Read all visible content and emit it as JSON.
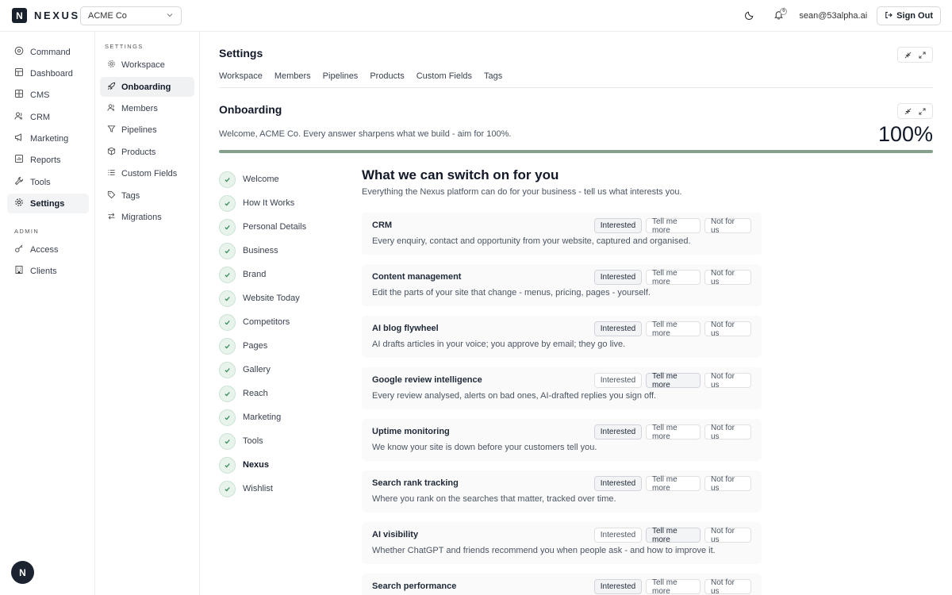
{
  "topbar": {
    "logo_letter": "N",
    "logo_text": "NEXUS",
    "workspace": "ACME Co",
    "notifications": "6",
    "user": "sean@53alpha.ai",
    "sign_out": "Sign Out"
  },
  "nav": [
    {
      "label": "Command",
      "icon": "command-icon"
    },
    {
      "label": "Dashboard",
      "icon": "dashboard-icon"
    },
    {
      "label": "CMS",
      "icon": "cms-icon"
    },
    {
      "label": "CRM",
      "icon": "crm-icon"
    },
    {
      "label": "Marketing",
      "icon": "megaphone-icon"
    },
    {
      "label": "Reports",
      "icon": "reports-icon"
    },
    {
      "label": "Tools",
      "icon": "wrench-icon"
    },
    {
      "label": "Settings",
      "icon": "gear-icon",
      "active": true
    }
  ],
  "admin": {
    "label": "ADMIN",
    "items": [
      {
        "label": "Access",
        "icon": "key-icon"
      },
      {
        "label": "Clients",
        "icon": "building-icon"
      }
    ]
  },
  "fab_letter": "N",
  "settings_nav": {
    "label": "SETTINGS",
    "items": [
      {
        "label": "Workspace",
        "icon": "gear-icon"
      },
      {
        "label": "Onboarding",
        "icon": "rocket-icon",
        "active": true
      },
      {
        "label": "Members",
        "icon": "users-icon"
      },
      {
        "label": "Pipelines",
        "icon": "funnel-icon"
      },
      {
        "label": "Products",
        "icon": "box-icon"
      },
      {
        "label": "Custom Fields",
        "icon": "list-icon"
      },
      {
        "label": "Tags",
        "icon": "tag-icon"
      },
      {
        "label": "Migrations",
        "icon": "migrate-icon"
      }
    ]
  },
  "main": {
    "title": "Settings",
    "tabs": [
      "Workspace",
      "Members",
      "Pipelines",
      "Products",
      "Custom Fields",
      "Tags"
    ]
  },
  "onboarding": {
    "title": "Onboarding",
    "welcome": "Welcome, ACME Co. Every answer sharpens what we build - aim for 100%.",
    "progress_label": "100%",
    "progress_value": 1.0,
    "steps": [
      {
        "label": "Welcome"
      },
      {
        "label": "How It Works"
      },
      {
        "label": "Personal Details"
      },
      {
        "label": "Business"
      },
      {
        "label": "Brand"
      },
      {
        "label": "Website Today"
      },
      {
        "label": "Competitors"
      },
      {
        "label": "Pages"
      },
      {
        "label": "Gallery"
      },
      {
        "label": "Reach"
      },
      {
        "label": "Marketing"
      },
      {
        "label": "Tools"
      },
      {
        "label": "Nexus",
        "current": true
      },
      {
        "label": "Wishlist"
      }
    ]
  },
  "services": {
    "title": "What we can switch on for you",
    "subtitle": "Everything the Nexus platform can do for your business - tell us what interests you.",
    "buttons": {
      "interested": "Interested",
      "tell": "Tell me more",
      "not": "Not for us"
    },
    "items": [
      {
        "title": "CRM",
        "desc": "Every enquiry, contact and opportunity from your website, captured and organised.",
        "choice": "interested"
      },
      {
        "title": "Content management",
        "desc": "Edit the parts of your site that change - menus, pricing, pages - yourself.",
        "choice": "interested"
      },
      {
        "title": "AI blog flywheel",
        "desc": "AI drafts articles in your voice; you approve by email; they go live.",
        "choice": "interested"
      },
      {
        "title": "Google review intelligence",
        "desc": "Every review analysed, alerts on bad ones, AI-drafted replies you sign off.",
        "choice": "tell"
      },
      {
        "title": "Uptime monitoring",
        "desc": "We know your site is down before your customers tell you.",
        "choice": "interested"
      },
      {
        "title": "Search rank tracking",
        "desc": "Where you rank on the searches that matter, tracked over time.",
        "choice": "interested"
      },
      {
        "title": "AI visibility",
        "desc": "Whether ChatGPT and friends recommend you when people ask - and how to improve it.",
        "choice": "tell"
      },
      {
        "title": "Search performance",
        "desc": "",
        "choice": "interested"
      }
    ]
  }
}
